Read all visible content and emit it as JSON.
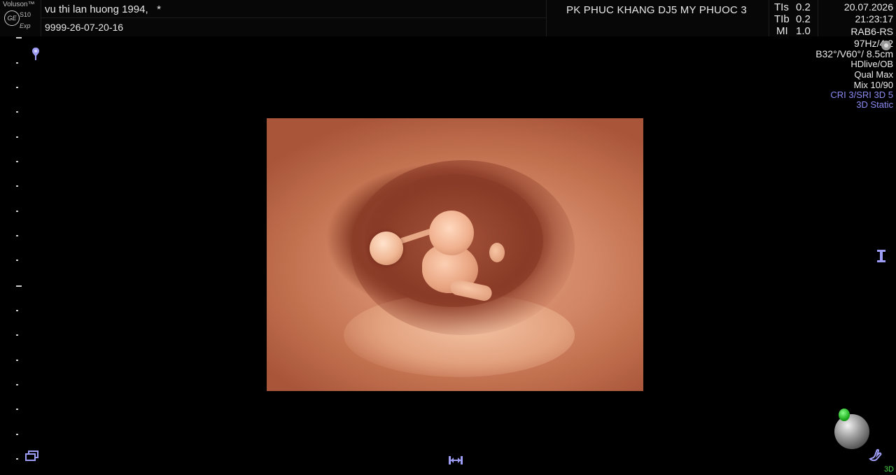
{
  "header": {
    "brand": "Voluson™",
    "model": "S10",
    "edition": "Exp",
    "logo_text": "GE",
    "patient_name": "vu thi lan huong 1994,   *",
    "patient_id": "9999-26-07-20-16",
    "clinic": "PK PHUC KHANG DJ5 MY PHUOC 3",
    "indices": [
      {
        "label": "TIs",
        "value": "0.2"
      },
      {
        "label": "TIb",
        "value": "0.2"
      },
      {
        "label": "MI",
        "value": "1.0"
      }
    ],
    "date": "20.07.2026",
    "time": "21:23:17"
  },
  "parameters": [
    "RAB6-RS",
    "97Hz/4.2",
    "B32°/V60°/ 8.5cm",
    "HDlive/OB",
    "Qual Max",
    "Mix 10/90",
    "CRI 3/SRI 3D 5",
    "3D Static"
  ],
  "mode_badge": "3D",
  "colors": {
    "background": "#000000",
    "text": "#e6e6e6",
    "highlight_blue": "#8c8cf4",
    "status_green": "#4ad44a",
    "render_tissue": "#d28766"
  },
  "icons": {
    "focus_marker": "focus-pin-icon",
    "orientation": "orientation-marker-icon",
    "layout": "layout-boxes-icon",
    "rotate": "left-right-arrows-icon",
    "hand": "hand-icon",
    "probe": "probe-icon",
    "trackball": "trackball-icon"
  }
}
